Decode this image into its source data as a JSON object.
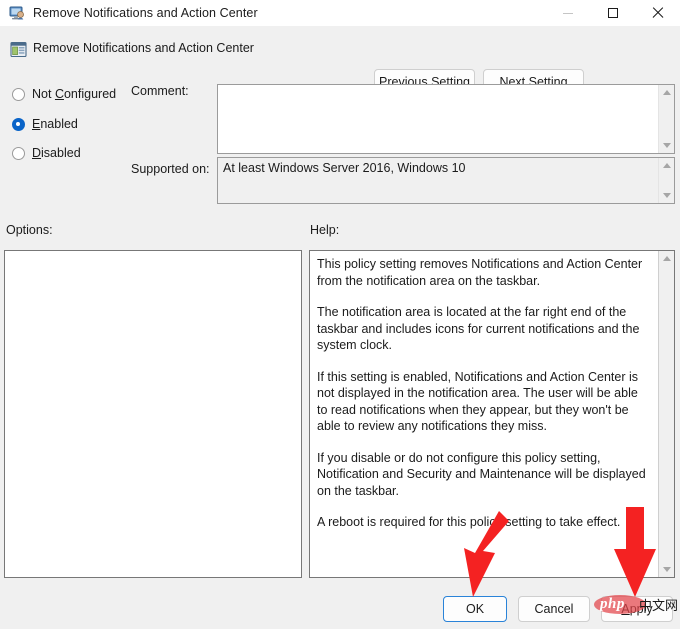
{
  "window": {
    "title": "Remove Notifications and Action Center",
    "icon": "policy-monitor-icon",
    "controls": {
      "minimize": "minimize-icon",
      "maximize": "maximize-icon",
      "close": "close-icon"
    }
  },
  "header": {
    "policy_icon": "group-policy-setting-icon",
    "policy_name": "Remove Notifications and Action Center",
    "previous_setting": "Previous Setting",
    "previous_setting_accel": "P",
    "next_setting": "Next Setting",
    "next_setting_accel": "N"
  },
  "state": {
    "options": [
      {
        "label": "Not Configured",
        "accel": "C",
        "selected": false
      },
      {
        "label": "Enabled",
        "accel": "E",
        "selected": true
      },
      {
        "label": "Disabled",
        "accel": "D",
        "selected": false
      }
    ],
    "selected_value": "Enabled"
  },
  "comment": {
    "label": "Comment:",
    "value": "",
    "placeholder": ""
  },
  "supported_on": {
    "label": "Supported on:",
    "value": "At least Windows Server 2016, Windows 10"
  },
  "options_panel": {
    "label": "Options:",
    "value": ""
  },
  "help_panel": {
    "label": "Help:",
    "paragraphs": [
      "This policy setting removes Notifications and Action Center from the notification area on the taskbar.",
      "The notification area is located at the far right end of the taskbar and includes icons for current notifications and the system clock.",
      "If this setting is enabled, Notifications and Action Center is not displayed in the notification area. The user will be able to read notifications when they appear, but they won't be able to review any notifications they miss.",
      "If you disable or do not configure this policy setting, Notification and Security and Maintenance will be displayed on the taskbar.",
      "A reboot is required for this policy setting to take effect."
    ]
  },
  "footer": {
    "ok": "OK",
    "cancel": "Cancel",
    "apply": "Apply",
    "apply_accel": "A",
    "default_button": "OK"
  },
  "annotations": {
    "color": "#f42222",
    "arrows": [
      {
        "name": "arrow-pointing-to-ok",
        "target": "OK"
      },
      {
        "name": "arrow-pointing-to-apply",
        "target": "Apply"
      }
    ]
  },
  "watermark": {
    "latin": "php",
    "chinese": "中文网",
    "color": "#e2444a"
  }
}
